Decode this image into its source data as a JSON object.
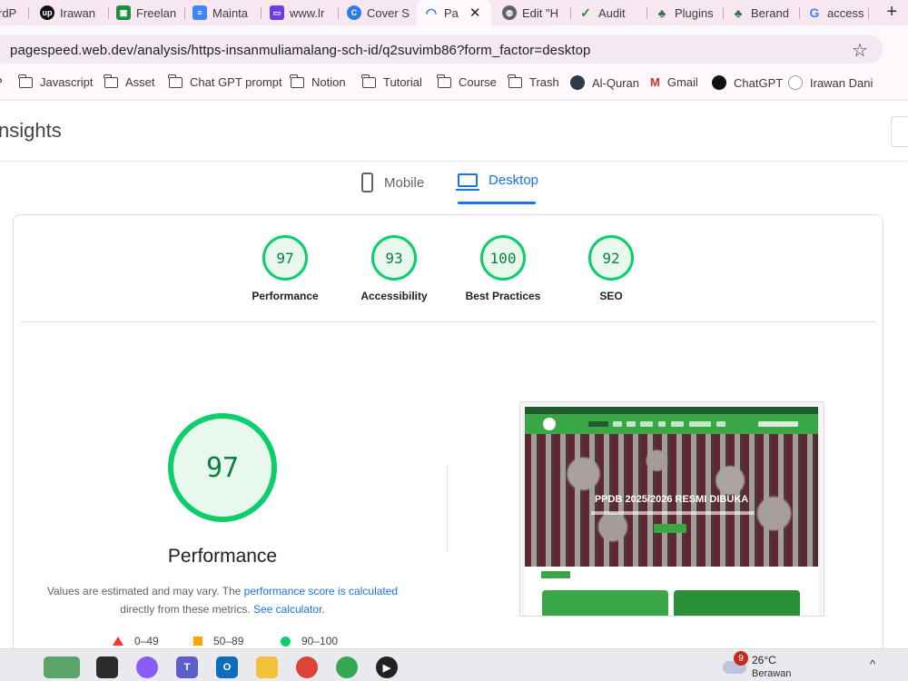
{
  "browser": {
    "tabs": [
      {
        "label": "rdP",
        "icon": "wordpress-icon",
        "color": "#4a4a4a"
      },
      {
        "label": "Irawan",
        "icon": "upwork-icon",
        "color": "#111111"
      },
      {
        "label": "Freelan",
        "icon": "sheets-icon",
        "color": "#1e8e3e"
      },
      {
        "label": "Mainta",
        "icon": "docs-icon",
        "color": "#4285f4"
      },
      {
        "label": "www.lr",
        "icon": "site-icon",
        "color": "#6a3de8"
      },
      {
        "label": "Cover S",
        "icon": "copilot-icon",
        "color": "#2b7de9"
      },
      {
        "label": "Pa",
        "icon": "pagespeed-icon",
        "color": "#1a73e8"
      },
      {
        "label": "Edit \"H",
        "icon": "globe-icon",
        "color": "#5f6368"
      },
      {
        "label": "Audit",
        "icon": "check-icon",
        "color": "#1e8e3e"
      },
      {
        "label": "Plugins",
        "icon": "plugin-icon",
        "color": "#2c6e49"
      },
      {
        "label": "Berand",
        "icon": "plugin-icon",
        "color": "#2c6e49"
      },
      {
        "label": "access",
        "icon": "google-icon",
        "color": "#4285f4"
      }
    ],
    "close_glyph": "✕",
    "new_tab_glyph": "+",
    "url": "pagespeed.web.dev/analysis/https-insanmuliamalang-sch-id/q2suvimb86?form_factor=desktop",
    "star_glyph": "☆",
    "bookmarks": [
      {
        "label": "Javascript",
        "icon": "folder-icon"
      },
      {
        "label": "Asset",
        "icon": "folder-icon"
      },
      {
        "label": "Chat GPT prompt",
        "icon": "folder-icon"
      },
      {
        "label": "Notion",
        "icon": "folder-icon"
      },
      {
        "label": "Tutorial",
        "icon": "folder-icon"
      },
      {
        "label": "Course",
        "icon": "folder-icon"
      },
      {
        "label": "Trash",
        "icon": "folder-icon"
      },
      {
        "label": "Al-Quran",
        "icon": "quran-icon"
      },
      {
        "label": "Gmail",
        "icon": "gmail-icon"
      },
      {
        "label": "ChatGPT",
        "icon": "chatgpt-icon"
      },
      {
        "label": "Irawan Dani",
        "icon": "id-icon"
      }
    ]
  },
  "page": {
    "brand": "nsights",
    "device_tabs": {
      "mobile": "Mobile",
      "desktop": "Desktop"
    },
    "scores": [
      {
        "label": "Performance",
        "value": "97"
      },
      {
        "label": "Accessibility",
        "value": "93"
      },
      {
        "label": "Best Practices",
        "value": "100"
      },
      {
        "label": "SEO",
        "value": "92"
      }
    ],
    "main_score": "97",
    "main_title": "Performance",
    "note": {
      "part1": "Values are estimated and may vary. The ",
      "link1": "performance score is calculated",
      "part2": " directly from these metrics. ",
      "link2": "See calculator."
    },
    "legend": [
      {
        "range": "0–49",
        "color": "#ff3333"
      },
      {
        "range": "50–89",
        "color": "#ffa400"
      },
      {
        "range": "90–100",
        "color": "#0cce6b"
      }
    ],
    "thumbnail": {
      "hero_title": "PPDB 2025/2026 RESMI DIBUKA"
    }
  },
  "taskbar": {
    "weather_badge": "9",
    "temperature": "26°C",
    "condition": "Berawan",
    "tray_chevron": "^"
  }
}
